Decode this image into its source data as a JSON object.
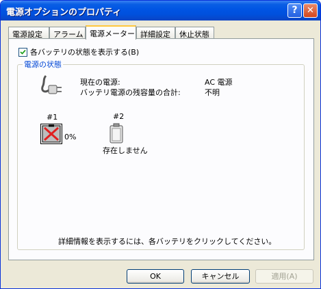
{
  "window": {
    "title": "電源オプションのプロパティ"
  },
  "titlebar_buttons": {
    "help": "?",
    "close": "✕"
  },
  "tabs": [
    {
      "label": "電源設定",
      "active": false
    },
    {
      "label": "アラーム",
      "active": false
    },
    {
      "label": "電源メーター",
      "active": true
    },
    {
      "label": "詳細設定",
      "active": false
    },
    {
      "label": "休止状態",
      "active": false
    }
  ],
  "options": {
    "show_each_battery": {
      "label": "各バッテリの状態を表示する(B)",
      "checked": true
    }
  },
  "status_group": {
    "title": "電源の状態",
    "current_source_label": "現在の電源:",
    "current_source_value": "AC 電源",
    "remaining_label": "バッテリ電源の残容量の合計:",
    "remaining_value": "不明",
    "batteries": [
      {
        "id": "#1",
        "level": "0%",
        "icon": "battery-missing-icon"
      },
      {
        "id": "#2",
        "status": "存在しません",
        "icon": "battery-empty-icon"
      }
    ],
    "hint": "詳細情報を表示するには、各バッテリをクリックしてください。"
  },
  "buttons": {
    "ok": "OK",
    "cancel": "キャンセル",
    "apply": "適用(A)"
  }
}
